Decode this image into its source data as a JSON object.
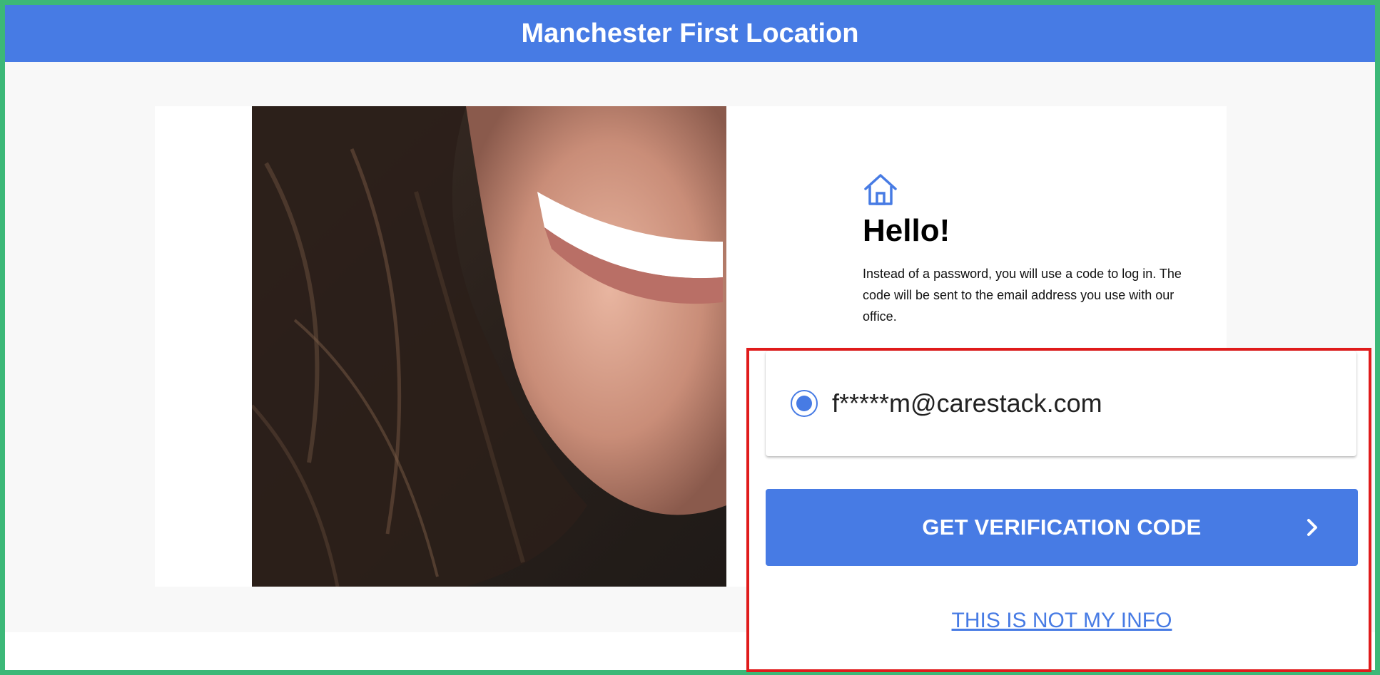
{
  "header": {
    "title": "Manchester First Location"
  },
  "login": {
    "heading": "Hello!",
    "instructions": "Instead of a password, you will use a code to log in. The code will be sent to the email address you use with our office."
  },
  "contact_options": {
    "selected": 0,
    "items": [
      {
        "value": "f*****m@carestack.com"
      }
    ]
  },
  "actions": {
    "get_code_label": "GET VERIFICATION CODE",
    "not_my_info_label": "THIS IS NOT MY INFO"
  },
  "icons": {
    "home": "home-icon",
    "next": "chevron-right-icon"
  },
  "colors": {
    "brand": "#477be4",
    "highlight_border": "#e01b1b",
    "frame_border": "#3cb878"
  }
}
